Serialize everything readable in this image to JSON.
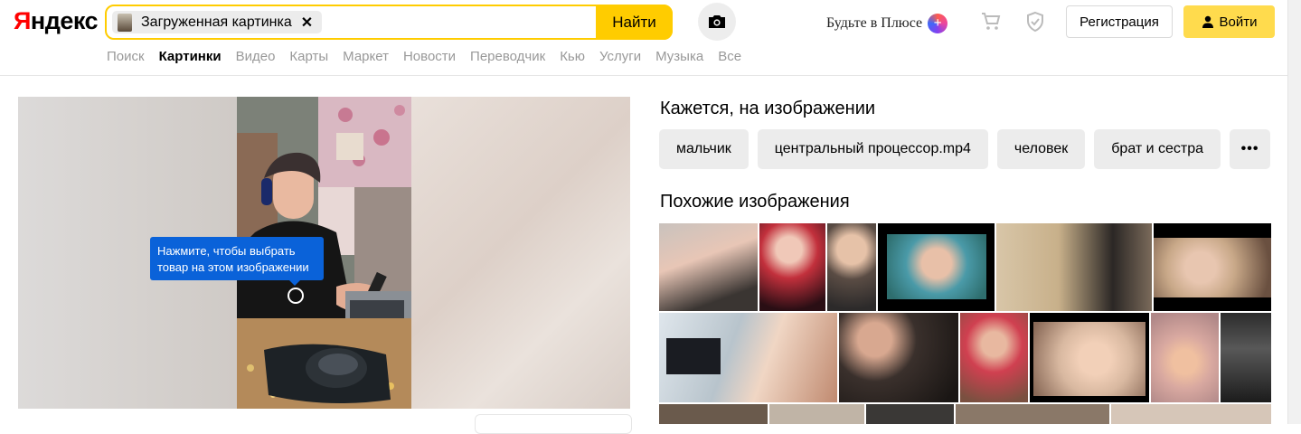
{
  "header": {
    "logo": "Яндекс",
    "search_chip_label": "Загруженная картинка",
    "search_button": "Найти",
    "plus_label": "Будьте в Плюсе",
    "register_button": "Регистрация",
    "login_button": "Войти"
  },
  "nav": [
    "Поиск",
    "Картинки",
    "Видео",
    "Карты",
    "Маркет",
    "Новости",
    "Переводчик",
    "Кью",
    "Услуги",
    "Музыка",
    "Все"
  ],
  "nav_active": "Картинки",
  "viewer": {
    "tooltip": "Нажмите, чтобы выбрать товар на этом изображении"
  },
  "recognition": {
    "title": "Кажется, на изображении",
    "tags": [
      "мальчик",
      "центральный процессор.mp4",
      "человек",
      "брат и сестра"
    ]
  },
  "similar": {
    "title": "Похожие изображения"
  },
  "colors": {
    "accent": "#ffcc00",
    "login_bg": "#ffdb4d",
    "tooltip_bg": "#0a62d9",
    "logo_red": "#ff0000"
  }
}
